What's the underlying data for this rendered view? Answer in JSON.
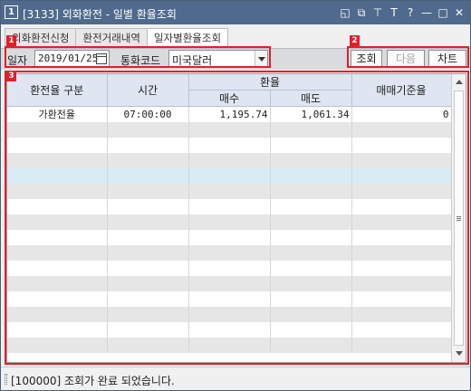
{
  "window": {
    "icon_label": "1",
    "title": "[3133] 외화환전 - 일별 환율조회",
    "controls": [
      "◱",
      "⧉",
      "⊤",
      "T",
      "?",
      "—",
      "□",
      "✕"
    ]
  },
  "tabs": [
    {
      "label": "외화환전신청"
    },
    {
      "label": "환전거래내역"
    },
    {
      "label": "일자별환율조회"
    }
  ],
  "toolbar": {
    "date_label": "일자",
    "date_value": "2019/01/25",
    "currency_label": "통화코드",
    "currency_value": "미국달러",
    "query_button": "조회",
    "next_button": "다음",
    "chart_button": "차트"
  },
  "annotations": {
    "badge1": "1",
    "badge2": "2",
    "badge3": "3"
  },
  "grid": {
    "headers": {
      "type": "환전율 구분",
      "time": "시간",
      "rate_group": "환율",
      "buy": "매수",
      "sell": "매도",
      "base": "매매기준율"
    },
    "rows": [
      {
        "type": "가환전율",
        "time": "07:00:00",
        "buy": "1,195.74",
        "sell": "1,061.34",
        "base": "0"
      }
    ]
  },
  "status": {
    "message": "[100000] 조회가 완료 되었습니다."
  }
}
